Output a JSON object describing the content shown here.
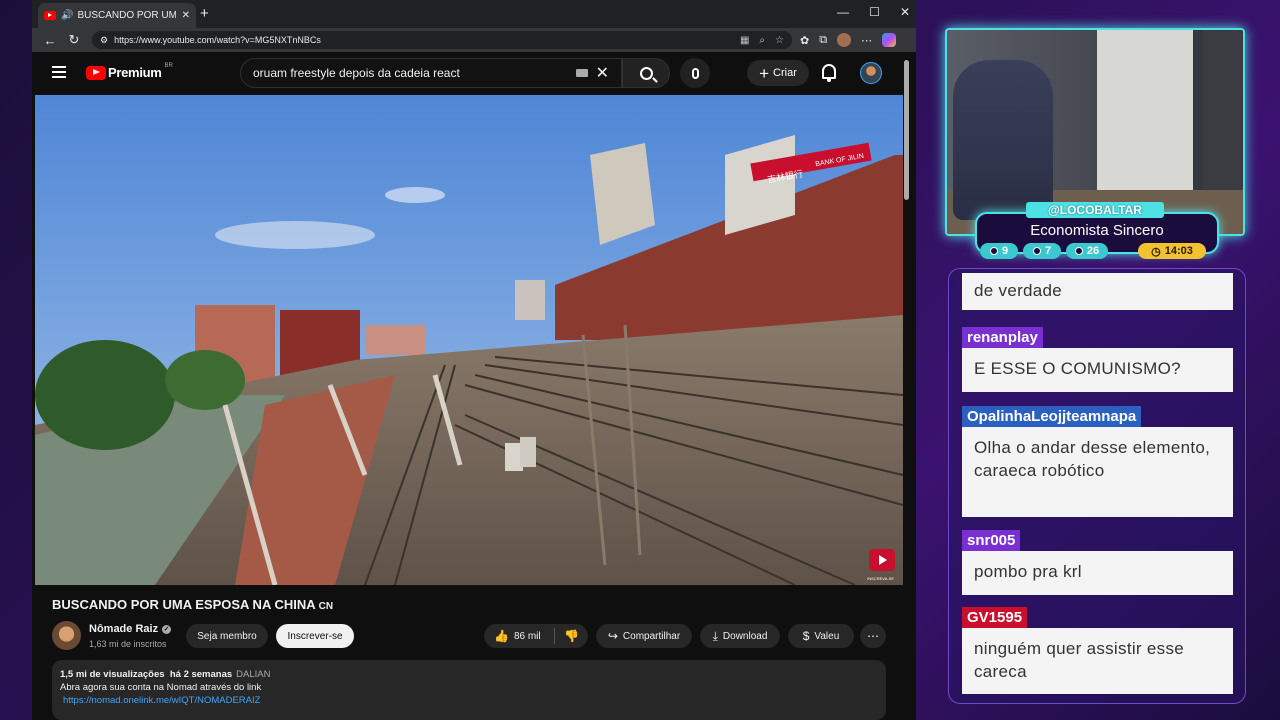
{
  "browser": {
    "tab_title": "BUSCANDO POR UMA ESPO",
    "url": "https://www.youtube.com/watch?v=MG5NXTnNBCs",
    "new_tab": "+",
    "win_min": "—",
    "win_max": "☐",
    "win_close": "✕"
  },
  "youtube": {
    "logo_text": "Premium",
    "logo_country": "BR",
    "search_query": "oruam freestyle depois da cadeia react",
    "create_label": "Criar"
  },
  "video": {
    "title": "BUSCANDO POR UMA ESPOSA NA CHINA",
    "title_tag": "CN",
    "channel_name": "Nômade Raiz",
    "subscribers": "1,63 mi de inscritos",
    "join_label": "Seja membro",
    "subscribe_label": "Inscrever-se",
    "likes": "86 mil",
    "share_label": "Compartilhar",
    "download_label": "Download",
    "thanks_label": "Valeu",
    "views": "1,5 mi de visualizações",
    "age": "há 2 semanas",
    "desc_tag": "DALIAN",
    "desc_line1": "Abra agora sua conta na Nomad através do link",
    "desc_link": "https://nomad.onelink.me/wIQT/NOMADERAIZ",
    "sign_text_1": "吉林银行",
    "sign_text_2": "BANK OF JILIN",
    "watermark_label": "INSCREVA-SE"
  },
  "stream": {
    "handle": "@LOCOBALTAR",
    "display_name": "Economista Sincero",
    "stats": [
      "9",
      "7",
      "26"
    ],
    "time": "14:03"
  },
  "chat": {
    "messages": [
      {
        "user": "",
        "text": "de verdade",
        "color": "#7a2fd0"
      },
      {
        "user": "renanplay",
        "text": "E ESSE O COMUNISMO?",
        "color": "#7a2fd0"
      },
      {
        "user": "OpalinhaLeojjteamnapa",
        "text": "Olha o andar desse elemento, caraeca robótico",
        "color": "#2b60c0"
      },
      {
        "user": "snr005",
        "text": "pombo pra krl",
        "color": "#7a2fd0"
      },
      {
        "user": "GV1595",
        "text": "ninguém quer assistir esse careca",
        "color": "#c8102e"
      }
    ]
  }
}
